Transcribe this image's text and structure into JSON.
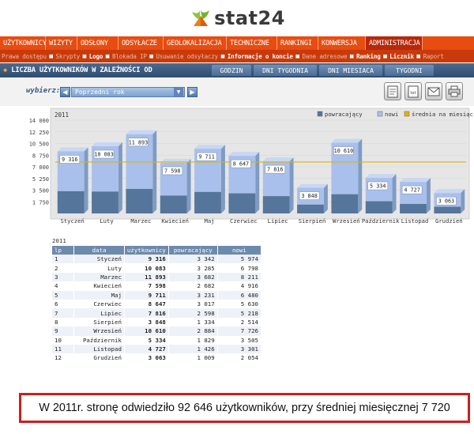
{
  "logo": {
    "text": "stat24"
  },
  "main_nav": {
    "items": [
      {
        "label": "UŻYTKOWNICY",
        "width": 58
      },
      {
        "label": "WIZYTY",
        "width": 40
      },
      {
        "label": "ODSŁONY",
        "width": 52
      },
      {
        "label": "ODSYŁACZE",
        "width": 57
      },
      {
        "label": "GEOLOKALIZACJA",
        "width": 80
      },
      {
        "label": "TECHNICZNE",
        "width": 64
      },
      {
        "label": "RANKINGI",
        "width": 52
      },
      {
        "label": "KONWERSJA",
        "width": 60
      },
      {
        "label": "ADMINISTRACJA",
        "width": 72,
        "active": true
      }
    ]
  },
  "sub_nav": {
    "items": [
      {
        "label": "Prawa dostępu",
        "bold": false
      },
      {
        "label": "Skrypty",
        "bold": false
      },
      {
        "label": "Logo",
        "bold": true
      },
      {
        "label": "Blokada IP",
        "bold": false
      },
      {
        "label": "Usuwanie odsyłaczy",
        "bold": false
      },
      {
        "label": "Informacje o koncie",
        "bold": true
      },
      {
        "label": "Dane adresowe",
        "bold": false
      },
      {
        "label": "Ranking",
        "bold": true
      },
      {
        "label": "Licznik",
        "bold": true
      },
      {
        "label": "Raport",
        "bold": false
      }
    ]
  },
  "section": {
    "title": "LICZBA UŻYTKOWNIKÓW W ZALEŻNOŚCI OD",
    "tabs": [
      {
        "label": "GODZIN",
        "width": 50
      },
      {
        "label": "DNI TYGODNIA",
        "width": 80
      },
      {
        "label": "DNI MIESIACA",
        "width": 80
      },
      {
        "label": "TYGODNI",
        "width": 62
      }
    ]
  },
  "toolbar": {
    "choose_label": "wybierz:",
    "period_value": "Poprzedni rok",
    "prev_icon": "arrow-left-icon",
    "next_icon": "arrow-right-icon",
    "tools": [
      "document-icon",
      "text-document-icon",
      "email-icon",
      "printer-icon"
    ]
  },
  "colors": {
    "accent_orange": "#e84c10",
    "nav_blue": "#2f4c70",
    "bar_light": "#a9c0ec",
    "bar_dark": "#56759b",
    "average_line": "#e0b400",
    "summary_border": "#cc1f1f"
  },
  "chart_data": {
    "type": "bar",
    "year_label": "2011",
    "legend": [
      {
        "label": "powracający",
        "color": "#56759b"
      },
      {
        "label": "nowi",
        "color": "#a9c0ec"
      },
      {
        "label": "średnia na miesiąc",
        "color": "#e0b400"
      }
    ],
    "yticks": [
      "14 000",
      "12 250",
      "10 500",
      "8 750",
      "7 000",
      "5 250",
      "3 500",
      "1 750"
    ],
    "ytick_values": [
      14000,
      12250,
      10500,
      8750,
      7000,
      5250,
      3500,
      1750
    ],
    "ylim": [
      0,
      14000
    ],
    "categories": [
      "Styczeń",
      "Luty",
      "Marzec",
      "Kwiecień",
      "Maj",
      "Czerwiec",
      "Lipiec",
      "Sierpień",
      "Wrzesień",
      "Październik",
      "Listopad",
      "Grudzień"
    ],
    "total_labels": [
      "9 316",
      "10 083",
      "11 893",
      "7 598",
      "9 711",
      "8 647",
      "7 816",
      "3 848",
      "10 610",
      "5 334",
      "4 727",
      "3 063"
    ],
    "series": [
      {
        "name": "powracający",
        "values": [
          3342,
          3285,
          3682,
          2682,
          3231,
          3017,
          2598,
          1334,
          2884,
          1829,
          1426,
          1009
        ]
      },
      {
        "name": "nowi",
        "values": [
          5974,
          6798,
          8211,
          4916,
          6480,
          5630,
          5218,
          2514,
          7726,
          3505,
          3301,
          2054
        ]
      }
    ],
    "totals": [
      9316,
      10083,
      11893,
      7598,
      9711,
      8647,
      7816,
      3848,
      10610,
      5334,
      4727,
      3063
    ],
    "average": 7720
  },
  "table": {
    "caption": "2011",
    "headers": [
      "lp",
      "data",
      "użytkownicy",
      "powracający",
      "nowi"
    ],
    "rows": [
      [
        "1",
        "Styczeń",
        "9 316",
        "3 342",
        "5 974"
      ],
      [
        "2",
        "Luty",
        "10 083",
        "3 285",
        "6 798"
      ],
      [
        "3",
        "Marzec",
        "11 893",
        "3 682",
        "8 211"
      ],
      [
        "4",
        "Kwiecień",
        "7 598",
        "2 682",
        "4 916"
      ],
      [
        "5",
        "Maj",
        "9 711",
        "3 231",
        "6 480"
      ],
      [
        "6",
        "Czerwiec",
        "8 647",
        "3 017",
        "5 630"
      ],
      [
        "7",
        "Lipiec",
        "7 816",
        "2 598",
        "5 218"
      ],
      [
        "8",
        "Sierpień",
        "3 848",
        "1 334",
        "2 514"
      ],
      [
        "9",
        "Wrzesień",
        "10 610",
        "2 884",
        "7 726"
      ],
      [
        "10",
        "Październik",
        "5 334",
        "1 829",
        "3 505"
      ],
      [
        "11",
        "Listopad",
        "4 727",
        "1 426",
        "3 301"
      ],
      [
        "12",
        "Grudzień",
        "3 063",
        "1 009",
        "2 054"
      ]
    ]
  },
  "summary": {
    "text": "W 2011r. stronę odwiedziło 92 646 użytkowników, przy średniej miesięcznej 7 720"
  }
}
